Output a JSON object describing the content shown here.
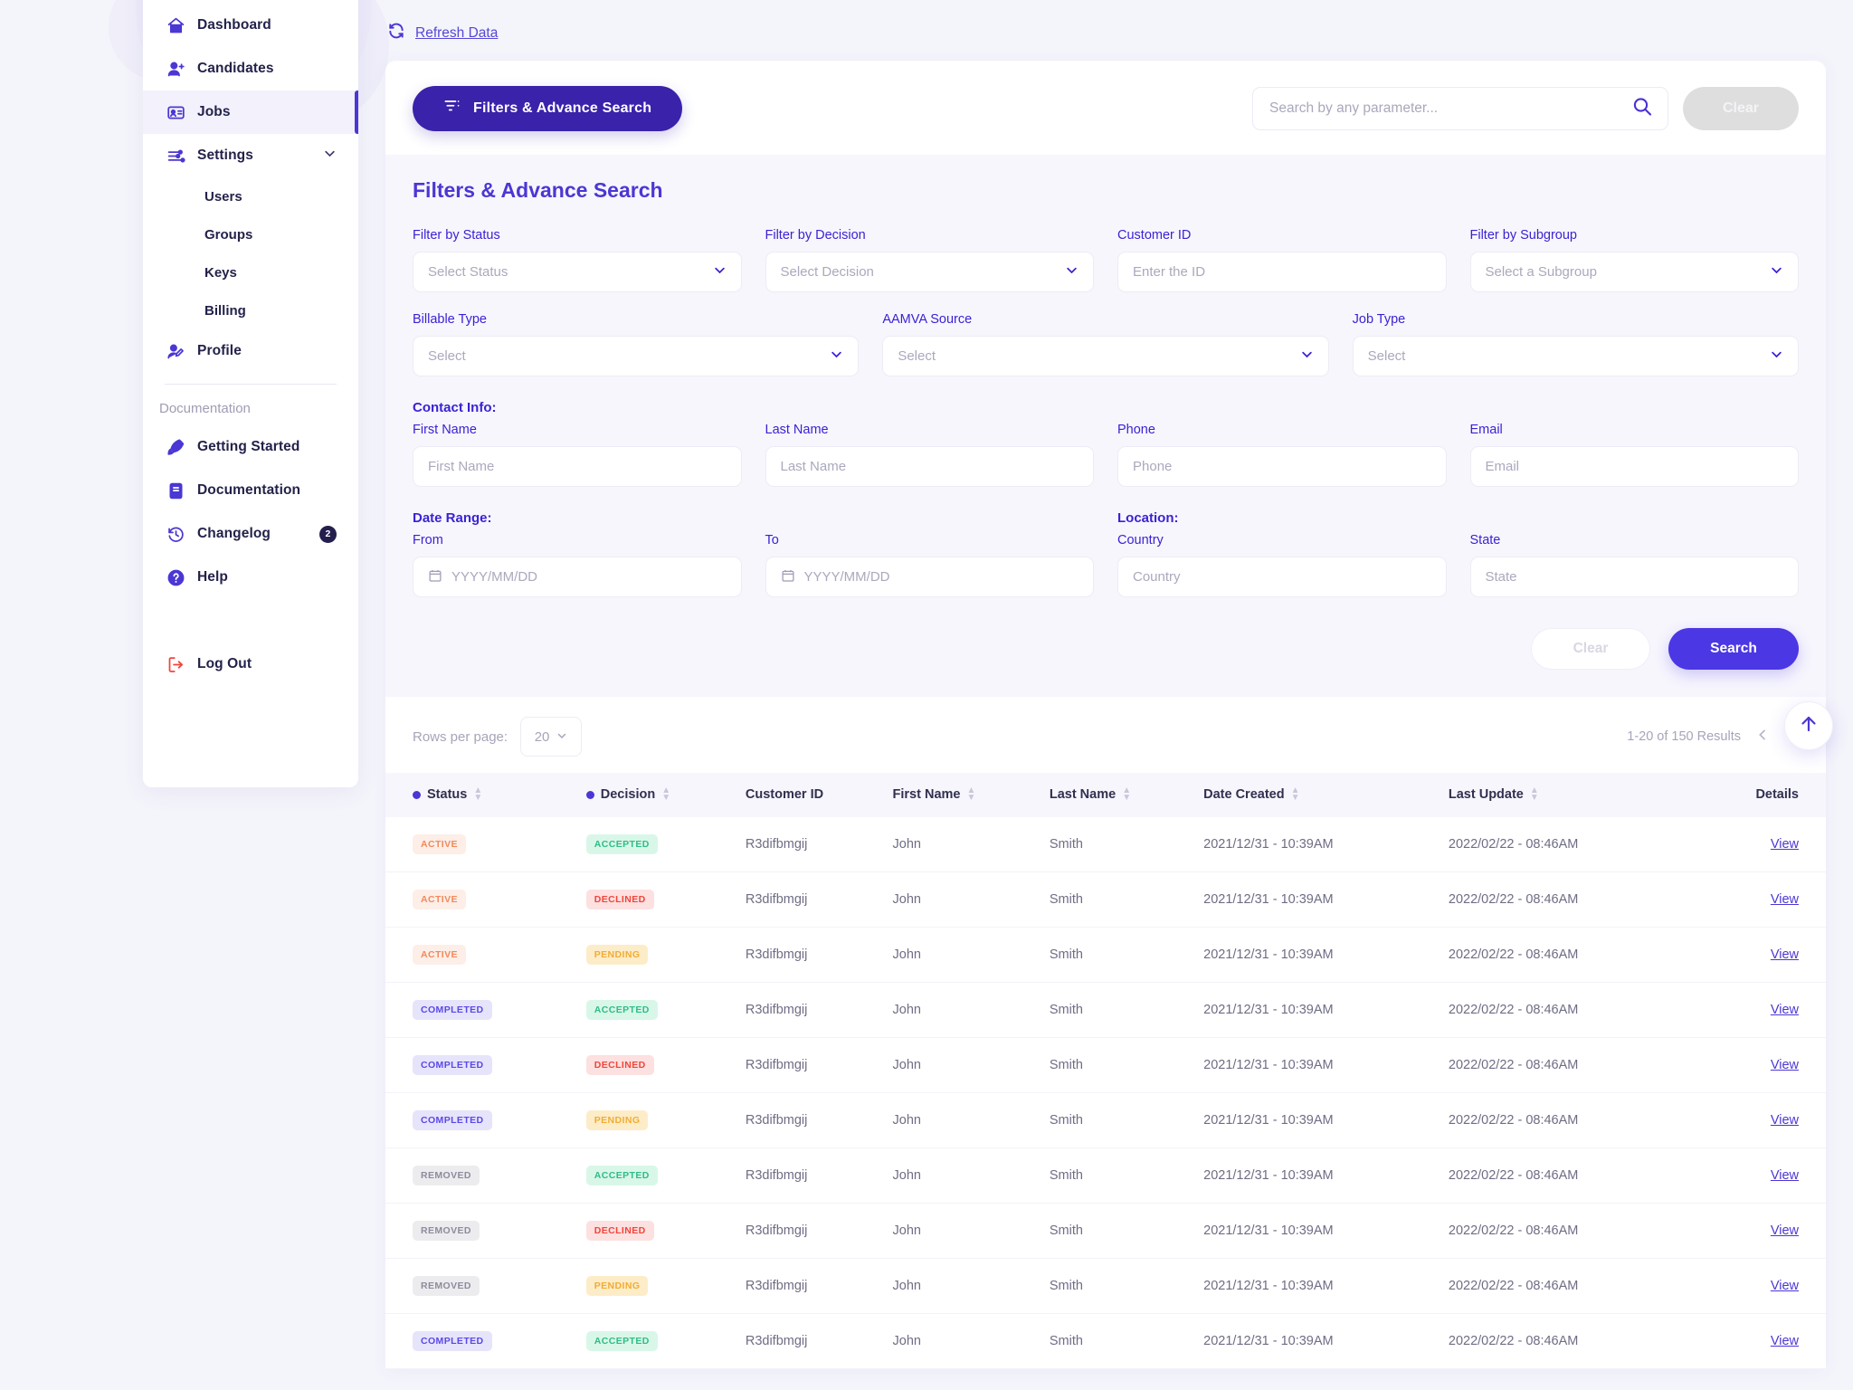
{
  "theme": {
    "primary": "#4b37d4",
    "primary_dark": "#3a22ab",
    "accent_text": "#3a22d4",
    "danger": "#f0453a"
  },
  "sidebar": {
    "items": [
      {
        "label": "Dashboard",
        "icon": "home-icon",
        "active": false
      },
      {
        "label": "Candidates",
        "icon": "user-plus-icon",
        "active": false
      },
      {
        "label": "Jobs",
        "icon": "id-card-icon",
        "active": true
      },
      {
        "label": "Settings",
        "icon": "sliders-icon",
        "active": false,
        "expanded": true
      }
    ],
    "settings_children": [
      {
        "label": "Users"
      },
      {
        "label": "Groups"
      },
      {
        "label": "Keys"
      },
      {
        "label": "Billing"
      }
    ],
    "profile": {
      "label": "Profile",
      "icon": "user-edit-icon"
    },
    "section_title": "Documentation",
    "doc_items": [
      {
        "label": "Getting Started",
        "icon": "rocket-icon",
        "badge": ""
      },
      {
        "label": "Documentation",
        "icon": "book-icon",
        "badge": ""
      },
      {
        "label": "Changelog",
        "icon": "history-icon",
        "badge": "2"
      },
      {
        "label": "Help",
        "icon": "question-circle-icon",
        "badge": ""
      }
    ],
    "logout": {
      "label": "Log Out",
      "icon": "logout-icon"
    }
  },
  "header": {
    "refresh_label": "Refresh Data",
    "refresh_icon": "refresh-icon"
  },
  "toolbar": {
    "filters_button": "Filters & Advance Search",
    "filters_icon": "filter-icon",
    "search_placeholder": "Search by any parameter...",
    "search_value": "",
    "search_icon": "search-icon",
    "clear_label": "Clear"
  },
  "filters": {
    "title": "Filters & Advance Search",
    "row1": [
      {
        "label": "Filter by Status",
        "placeholder": "Select Status",
        "type": "select"
      },
      {
        "label": "Filter by Decision",
        "placeholder": "Select Decision",
        "type": "select"
      },
      {
        "label": "Customer ID",
        "placeholder": "Enter the ID",
        "type": "text"
      },
      {
        "label": "Filter by Subgroup",
        "placeholder": "Select a Subgroup",
        "type": "select"
      }
    ],
    "row2": [
      {
        "label": "Billable Type",
        "placeholder": "Select",
        "type": "select"
      },
      {
        "label": "AAMVA Source",
        "placeholder": "Select",
        "type": "select"
      },
      {
        "label": "Job Type",
        "placeholder": "Select",
        "type": "select"
      }
    ],
    "contact_section": "Contact Info:",
    "row3": [
      {
        "label": "First Name",
        "placeholder": "First Name",
        "type": "text"
      },
      {
        "label": "Last Name",
        "placeholder": "Last Name",
        "type": "text"
      },
      {
        "label": "Phone",
        "placeholder": "Phone",
        "type": "text"
      },
      {
        "label": "Email",
        "placeholder": "Email",
        "type": "text"
      }
    ],
    "date_section": "Date Range:",
    "location_section": "Location:",
    "row4": [
      {
        "label": "From",
        "placeholder": "YYYY/MM/DD",
        "type": "date"
      },
      {
        "label": "To",
        "placeholder": "YYYY/MM/DD",
        "type": "date"
      },
      {
        "label": "Country",
        "placeholder": "Country",
        "type": "text"
      },
      {
        "label": "State",
        "placeholder": "State",
        "type": "text"
      }
    ],
    "clear_label": "Clear",
    "search_label": "Search"
  },
  "results": {
    "rows_per_page_label": "Rows per page:",
    "rows_per_page_value": "20",
    "count_label": "1-20 of 150 Results",
    "prev_icon": "chevron-left-icon",
    "next_icon": "chevron-right-icon",
    "scroll_top_icon": "arrow-up-icon"
  },
  "table": {
    "columns": [
      {
        "label": "Status",
        "dot": true,
        "sortable": true
      },
      {
        "label": "Decision",
        "dot": true,
        "sortable": true
      },
      {
        "label": "Customer ID",
        "dot": false,
        "sortable": false
      },
      {
        "label": "First Name",
        "dot": false,
        "sortable": true
      },
      {
        "label": "Last Name",
        "dot": false,
        "sortable": true
      },
      {
        "label": "Date Created",
        "dot": false,
        "sortable": true
      },
      {
        "label": "Last Update",
        "dot": false,
        "sortable": true
      },
      {
        "label": "Details",
        "dot": false,
        "sortable": false
      }
    ],
    "badge_styles": {
      "ACTIVE": {
        "bg": "#fdeee7",
        "fg": "#f08a5d"
      },
      "COMPLETED": {
        "bg": "#e6e4fb",
        "fg": "#5b48e8"
      },
      "REMOVED": {
        "bg": "#ececef",
        "fg": "#8c8b9c"
      },
      "ACCEPTED": {
        "bg": "#d9f7e9",
        "fg": "#2fbd86"
      },
      "DECLINED": {
        "bg": "#fde0e0",
        "fg": "#f0453a"
      },
      "PENDING": {
        "bg": "#fdecc8",
        "fg": "#f0ad35"
      }
    },
    "view_label": "View",
    "rows": [
      {
        "status": "ACTIVE",
        "decision": "ACCEPTED",
        "customer_id": "R3difbmgij",
        "first_name": "John",
        "last_name": "Smith",
        "date_created": "2021/12/31 - 10:39AM",
        "last_update": "2022/02/22 - 08:46AM"
      },
      {
        "status": "ACTIVE",
        "decision": "DECLINED",
        "customer_id": "R3difbmgij",
        "first_name": "John",
        "last_name": "Smith",
        "date_created": "2021/12/31 - 10:39AM",
        "last_update": "2022/02/22 - 08:46AM"
      },
      {
        "status": "ACTIVE",
        "decision": "PENDING",
        "customer_id": "R3difbmgij",
        "first_name": "John",
        "last_name": "Smith",
        "date_created": "2021/12/31 - 10:39AM",
        "last_update": "2022/02/22 - 08:46AM"
      },
      {
        "status": "COMPLETED",
        "decision": "ACCEPTED",
        "customer_id": "R3difbmgij",
        "first_name": "John",
        "last_name": "Smith",
        "date_created": "2021/12/31 - 10:39AM",
        "last_update": "2022/02/22 - 08:46AM"
      },
      {
        "status": "COMPLETED",
        "decision": "DECLINED",
        "customer_id": "R3difbmgij",
        "first_name": "John",
        "last_name": "Smith",
        "date_created": "2021/12/31 - 10:39AM",
        "last_update": "2022/02/22 - 08:46AM"
      },
      {
        "status": "COMPLETED",
        "decision": "PENDING",
        "customer_id": "R3difbmgij",
        "first_name": "John",
        "last_name": "Smith",
        "date_created": "2021/12/31 - 10:39AM",
        "last_update": "2022/02/22 - 08:46AM"
      },
      {
        "status": "REMOVED",
        "decision": "ACCEPTED",
        "customer_id": "R3difbmgij",
        "first_name": "John",
        "last_name": "Smith",
        "date_created": "2021/12/31 - 10:39AM",
        "last_update": "2022/02/22 - 08:46AM"
      },
      {
        "status": "REMOVED",
        "decision": "DECLINED",
        "customer_id": "R3difbmgij",
        "first_name": "John",
        "last_name": "Smith",
        "date_created": "2021/12/31 - 10:39AM",
        "last_update": "2022/02/22 - 08:46AM"
      },
      {
        "status": "REMOVED",
        "decision": "PENDING",
        "customer_id": "R3difbmgij",
        "first_name": "John",
        "last_name": "Smith",
        "date_created": "2021/12/31 - 10:39AM",
        "last_update": "2022/02/22 - 08:46AM"
      },
      {
        "status": "COMPLETED",
        "decision": "ACCEPTED",
        "customer_id": "R3difbmgij",
        "first_name": "John",
        "last_name": "Smith",
        "date_created": "2021/12/31 - 10:39AM",
        "last_update": "2022/02/22 - 08:46AM"
      }
    ]
  }
}
